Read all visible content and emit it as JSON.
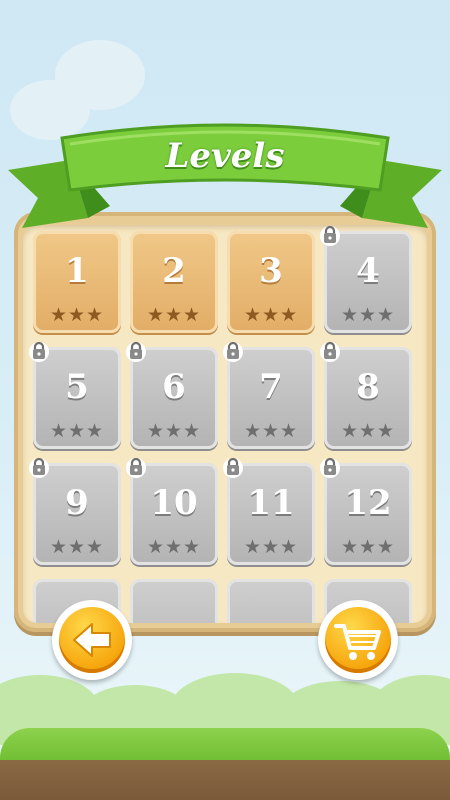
{
  "header": {
    "title": "Levels"
  },
  "levels": [
    {
      "number": "1",
      "state": "unlocked",
      "stars": "★★★"
    },
    {
      "number": "2",
      "state": "unlocked",
      "stars": "★★★"
    },
    {
      "number": "3",
      "state": "unlocked",
      "stars": "★★★"
    },
    {
      "number": "4",
      "state": "locked",
      "stars": "★★★"
    },
    {
      "number": "5",
      "state": "locked",
      "stars": "★★★"
    },
    {
      "number": "6",
      "state": "locked",
      "stars": "★★★"
    },
    {
      "number": "7",
      "state": "locked",
      "stars": "★★★"
    },
    {
      "number": "8",
      "state": "locked",
      "stars": "★★★"
    },
    {
      "number": "9",
      "state": "locked",
      "stars": "★★★"
    },
    {
      "number": "10",
      "state": "locked",
      "stars": "★★★"
    },
    {
      "number": "11",
      "state": "locked",
      "stars": "★★★"
    },
    {
      "number": "12",
      "state": "locked",
      "stars": "★★★"
    }
  ],
  "buttons": {
    "back": {
      "icon": "arrow-left-icon"
    },
    "shop": {
      "icon": "shopping-cart-icon"
    }
  },
  "colors": {
    "banner_green": "#7ccd3c",
    "board_tan": "#e8cc96",
    "unlocked_tile": "#e9b978",
    "locked_tile": "#c2c2c2",
    "button_orange": "#f6a50c"
  }
}
